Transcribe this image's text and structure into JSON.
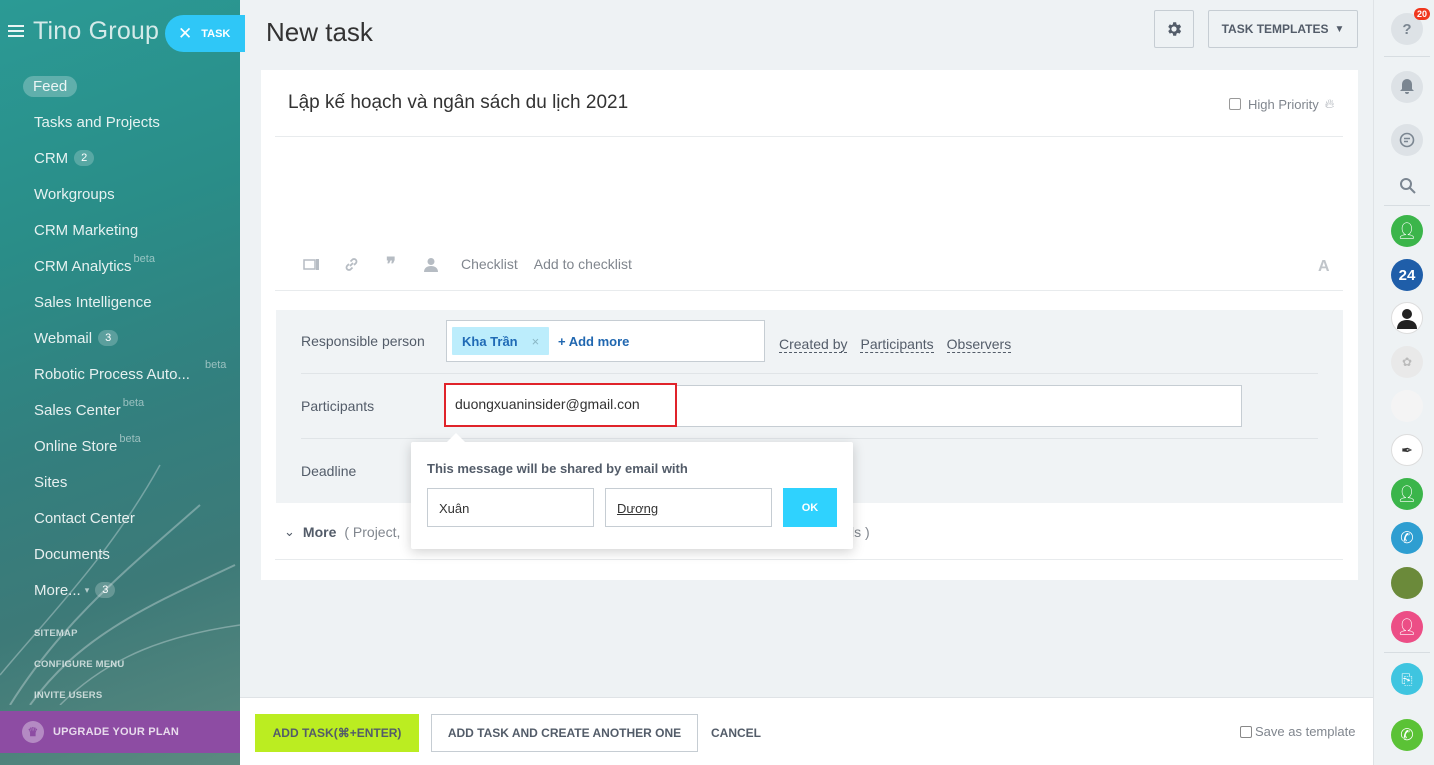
{
  "sidebar": {
    "logo": "Tino Group",
    "task_button": "TASK",
    "items": [
      {
        "label": "Feed"
      },
      {
        "label": "Tasks and Projects"
      },
      {
        "label": "CRM",
        "count": "2"
      },
      {
        "label": "Workgroups"
      },
      {
        "label": "CRM Marketing"
      },
      {
        "label": "CRM Analytics",
        "beta": "beta"
      },
      {
        "label": "Sales Intelligence"
      },
      {
        "label": "Webmail",
        "count": "3"
      },
      {
        "label": "Robotic Process Auto...",
        "beta": "beta"
      },
      {
        "label": "Sales Center",
        "beta": "beta"
      },
      {
        "label": "Online Store",
        "beta": "beta"
      },
      {
        "label": "Sites"
      },
      {
        "label": "Contact Center"
      },
      {
        "label": "Documents"
      },
      {
        "label": "More...",
        "count": "3"
      }
    ],
    "links": [
      "SITEMAP",
      "CONFIGURE MENU",
      "INVITE USERS"
    ],
    "upgrade": "UPGRADE YOUR PLAN"
  },
  "header": {
    "title": "New task",
    "templates_button": "TASK TEMPLATES"
  },
  "task": {
    "title": "Lập kế hoạch và ngân sách du lịch 2021",
    "high_priority": "High Priority",
    "high_priority_checked": false
  },
  "toolbar": {
    "checklist": "Checklist",
    "add_to_checklist": "Add to checklist",
    "font_icon": "A"
  },
  "fields": {
    "responsible_label": "Responsible person",
    "responsible_chip": "Kha Trần",
    "chip_remove": "×",
    "add_more": "+ Add more",
    "created_by": "Created by",
    "participants_link": "Participants",
    "observers": "Observers",
    "participants_label": "Participants",
    "participants_value": "duongxuaninsider@gmail.con",
    "deadline_label": "Deadline"
  },
  "more": {
    "label": "More",
    "hint_start": "( Project,",
    "hint_end": "ls )"
  },
  "popup": {
    "message": "This message will be shared by email with",
    "first_name": "Xuân",
    "last_name": "Dương",
    "ok": "OK"
  },
  "footer": {
    "add_task": "ADD TASK(⌘+ENTER)",
    "add_another": "ADD TASK AND CREATE ANOTHER ONE",
    "cancel": "CANCEL",
    "save_template": "Save as template"
  },
  "rightbar": {
    "help_badge": "20",
    "b24": "24"
  },
  "colors": {
    "accent": "#2fc7f7",
    "add_button": "#bbed21",
    "highlight_border": "#e0232a",
    "upgrade": "#8d4ca3"
  }
}
